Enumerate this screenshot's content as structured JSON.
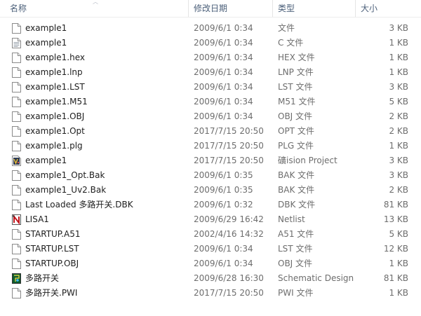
{
  "headers": {
    "name": "名称",
    "date": "修改日期",
    "type": "类型",
    "size": "大小"
  },
  "files": [
    {
      "name": "example1",
      "date": "2009/6/1 0:34",
      "type": "文件",
      "size": "3 KB",
      "icon": "blank-file-icon"
    },
    {
      "name": "example1",
      "date": "2009/6/1 0:34",
      "type": "C 文件",
      "size": "1 KB",
      "icon": "text-file-icon"
    },
    {
      "name": "example1.hex",
      "date": "2009/6/1 0:34",
      "type": "HEX 文件",
      "size": "1 KB",
      "icon": "blank-file-icon"
    },
    {
      "name": "example1.lnp",
      "date": "2009/6/1 0:34",
      "type": "LNP 文件",
      "size": "1 KB",
      "icon": "blank-file-icon"
    },
    {
      "name": "example1.LST",
      "date": "2009/6/1 0:34",
      "type": "LST 文件",
      "size": "3 KB",
      "icon": "blank-file-icon"
    },
    {
      "name": "example1.M51",
      "date": "2009/6/1 0:34",
      "type": "M51 文件",
      "size": "5 KB",
      "icon": "blank-file-icon"
    },
    {
      "name": "example1.OBJ",
      "date": "2009/6/1 0:34",
      "type": "OBJ 文件",
      "size": "2 KB",
      "icon": "blank-file-icon"
    },
    {
      "name": "example1.Opt",
      "date": "2017/7/15 20:50",
      "type": "OPT 文件",
      "size": "2 KB",
      "icon": "blank-file-icon"
    },
    {
      "name": "example1.plg",
      "date": "2017/7/15 20:50",
      "type": "PLG 文件",
      "size": "1 KB",
      "icon": "blank-file-icon"
    },
    {
      "name": "example1",
      "date": "2017/7/15 20:50",
      "type": "礦ision Project",
      "size": "3 KB",
      "icon": "uvision-project-icon"
    },
    {
      "name": "example1_Opt.Bak",
      "date": "2009/6/1 0:35",
      "type": "BAK 文件",
      "size": "3 KB",
      "icon": "blank-file-icon"
    },
    {
      "name": "example1_Uv2.Bak",
      "date": "2009/6/1 0:35",
      "type": "BAK 文件",
      "size": "2 KB",
      "icon": "blank-file-icon"
    },
    {
      "name": "Last Loaded 多路开关.DBK",
      "date": "2009/6/1 0:32",
      "type": "DBK 文件",
      "size": "81 KB",
      "icon": "blank-file-icon"
    },
    {
      "name": "LISA1",
      "date": "2009/6/29 16:42",
      "type": "Netlist",
      "size": "13 KB",
      "icon": "netlist-icon"
    },
    {
      "name": "STARTUP.A51",
      "date": "2002/4/16 14:32",
      "type": "A51 文件",
      "size": "5 KB",
      "icon": "blank-file-icon"
    },
    {
      "name": "STARTUP.LST",
      "date": "2009/6/1 0:34",
      "type": "LST 文件",
      "size": "12 KB",
      "icon": "blank-file-icon"
    },
    {
      "name": "STARTUP.OBJ",
      "date": "2009/6/1 0:34",
      "type": "OBJ 文件",
      "size": "1 KB",
      "icon": "blank-file-icon"
    },
    {
      "name": "多路开关",
      "date": "2009/6/28 16:30",
      "type": "Schematic Design",
      "size": "81 KB",
      "icon": "schematic-design-icon"
    },
    {
      "name": "多路开关.PWI",
      "date": "2017/7/15 20:50",
      "type": "PWI 文件",
      "size": "1 KB",
      "icon": "blank-file-icon"
    }
  ]
}
